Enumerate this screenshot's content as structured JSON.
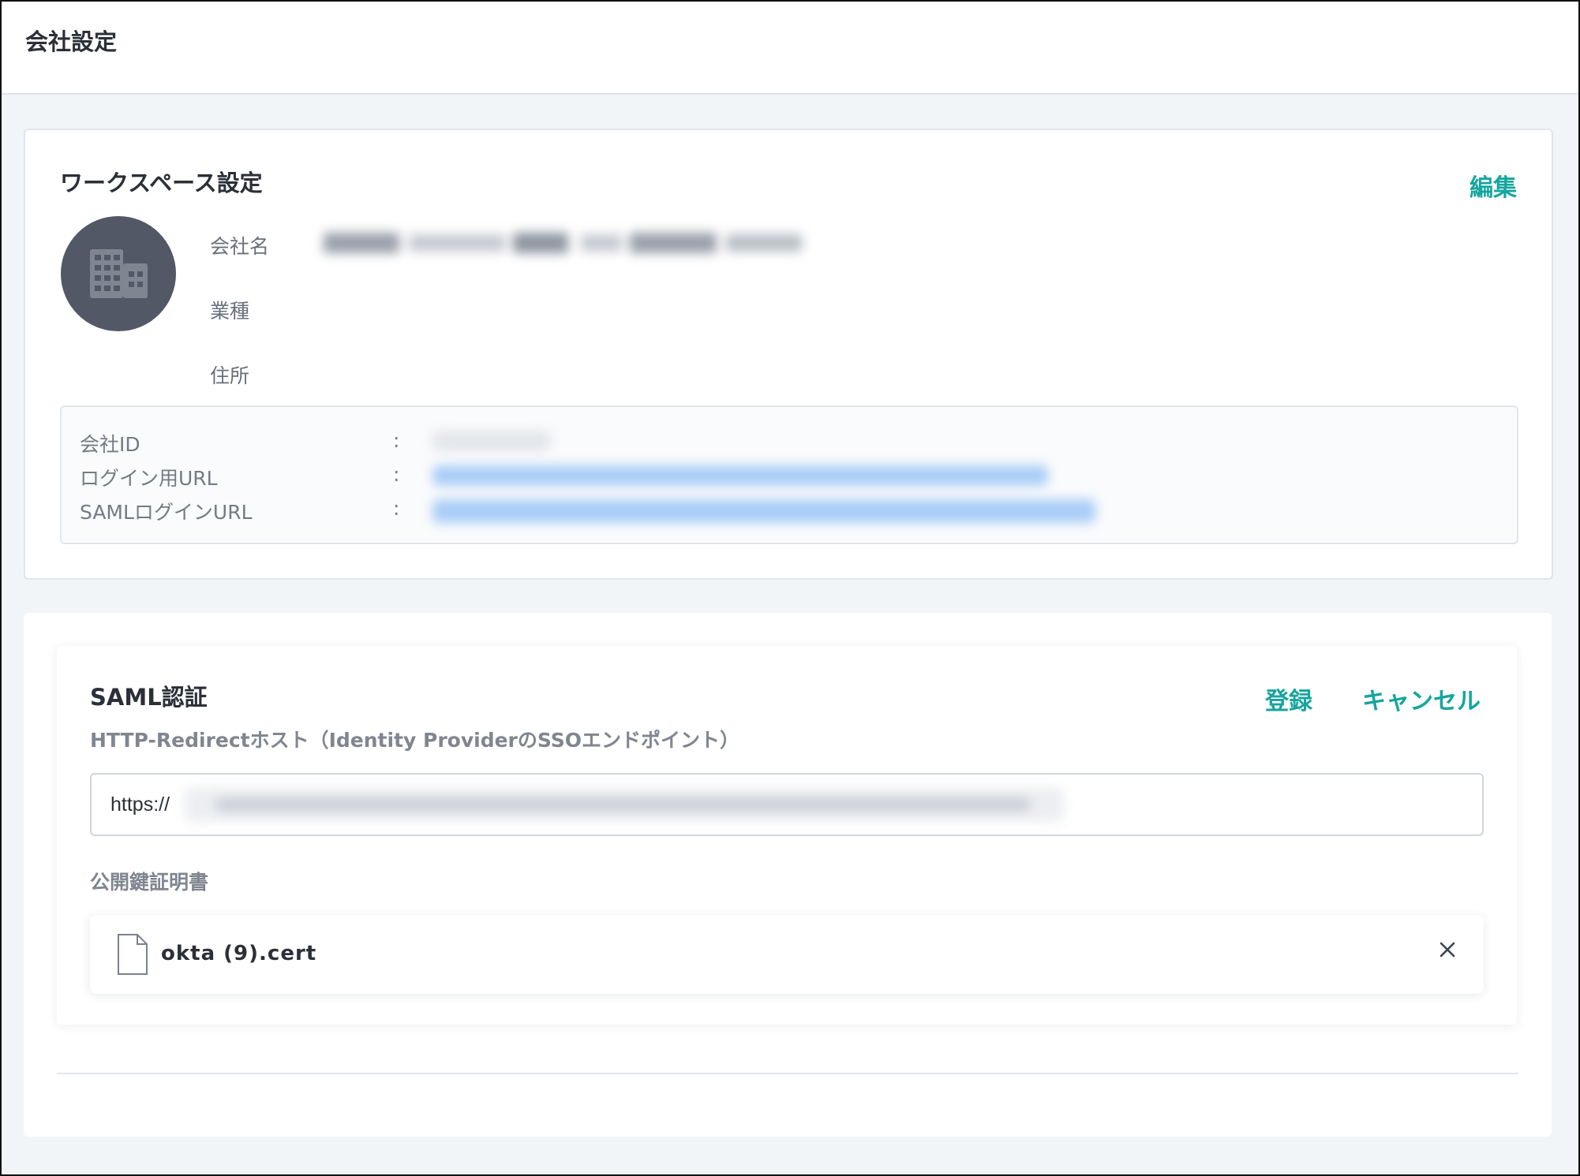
{
  "page": {
    "title": "会社設定"
  },
  "workspace": {
    "title": "ワークスペース設定",
    "edit_label": "編集",
    "avatar_icon": "building-icon",
    "fields": [
      {
        "label": "会社名"
      },
      {
        "label": "業種"
      },
      {
        "label": "住所"
      }
    ],
    "info": [
      {
        "label": "会社ID",
        "colon": ":"
      },
      {
        "label": "ログイン用URL",
        "colon": ":"
      },
      {
        "label": "SAMLログインURL",
        "colon": ":"
      }
    ]
  },
  "saml": {
    "title": "SAML認証",
    "register_label": "登録",
    "cancel_label": "キャンセル",
    "host_label": "HTTP-Redirectホスト（Identity ProviderのSSOエンドポイント）",
    "host_value": "https://",
    "cert_label": "公開鍵証明書",
    "cert_file": "okta (9).cert",
    "file_icon": "file-icon",
    "remove_icon": "close-icon"
  },
  "colors": {
    "accent": "#16a59e",
    "link_blurred": "#3d8ef0",
    "avatar_bg": "#525866"
  }
}
